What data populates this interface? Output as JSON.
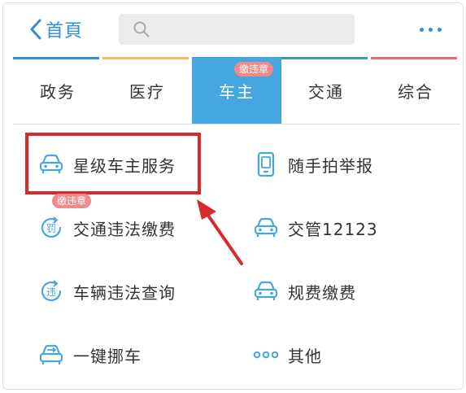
{
  "header": {
    "back_label": "首頁",
    "search_placeholder": "",
    "search_icon": "search-icon",
    "more_icon": "more-icon"
  },
  "tabs": [
    {
      "label": "政务",
      "color": "#2f8fd8"
    },
    {
      "label": "医疗",
      "color": "#f0c060"
    },
    {
      "label": "车主",
      "color": "#46a6e0",
      "active": true,
      "badge": "缴违章"
    },
    {
      "label": "交通",
      "color": "#3aa0a0"
    },
    {
      "label": "综合",
      "color": "#e07070"
    }
  ],
  "services": [
    {
      "label": "星级车主服务",
      "icon": "car-icon",
      "highlighted": true
    },
    {
      "label": "随手拍举报",
      "icon": "phone-icon"
    },
    {
      "label": "交通违法缴费",
      "icon": "fine-icon",
      "badge": "缴违章"
    },
    {
      "label": "交管12123",
      "icon": "car-icon"
    },
    {
      "label": "车辆违法查询",
      "icon": "violation-search-icon"
    },
    {
      "label": "规费缴费",
      "icon": "car-icon"
    },
    {
      "label": "一键挪车",
      "icon": "car-move-icon"
    },
    {
      "label": "其他",
      "icon": "more-dots-icon"
    }
  ],
  "colors": {
    "accent": "#2f8fd8",
    "active_tab": "#46a6e0",
    "badge": "#ee8a8a",
    "highlight": "#d72a2a"
  }
}
